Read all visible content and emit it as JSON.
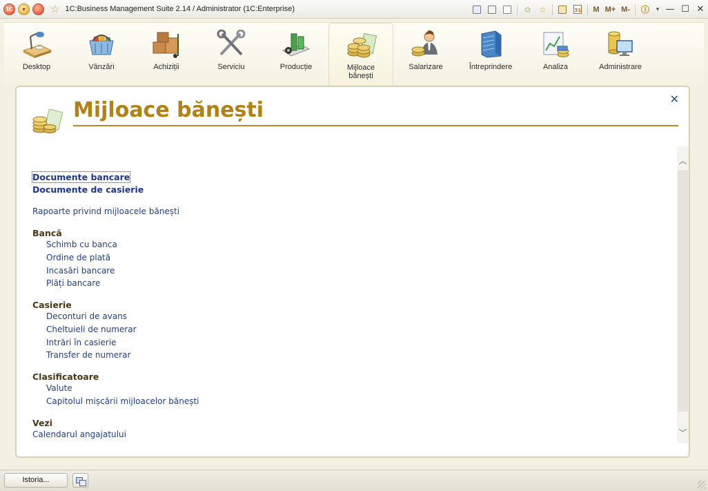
{
  "window": {
    "title": "1C:Business Management Suite 2.14 / Administrator  (1C:Enterprise)",
    "logo_text": "1C",
    "toolbar_text_buttons": [
      "M",
      "M+",
      "M-"
    ]
  },
  "sections": [
    {
      "label": "Desktop",
      "icon": "desk-lamp-icon"
    },
    {
      "label": "Vânzări",
      "icon": "shopping-basket-icon"
    },
    {
      "label": "Achiziții",
      "icon": "boxes-cart-icon"
    },
    {
      "label": "Serviciu",
      "icon": "wrench-icon"
    },
    {
      "label": "Producție",
      "icon": "factory-icon"
    },
    {
      "label": "Mijloace\nbănești",
      "icon": "coins-icon",
      "active": true
    },
    {
      "label": "Salarizare",
      "icon": "employee-icon"
    },
    {
      "label": "Întreprindere",
      "icon": "building-icon"
    },
    {
      "label": "Analiza",
      "icon": "chart-icon"
    },
    {
      "label": "Administrare",
      "icon": "database-computer-icon"
    }
  ],
  "page": {
    "title": "Mijloace bănești",
    "top_links": [
      "Documente bancare",
      "Documente de casierie"
    ],
    "report_link": "Rapoarte privind mijloacele bănești",
    "groups": [
      {
        "title": "Bancă",
        "items": [
          "Schimb cu banca",
          "Ordine de plată",
          "Incasări bancare",
          "Plăți bancare"
        ]
      },
      {
        "title": "Casierie",
        "items": [
          "Deconturi de avans",
          "Cheltuieli de numerar",
          "Intrări în casierie",
          "Transfer de numerar"
        ]
      },
      {
        "title": "Clasificatoare",
        "items": [
          "Valute",
          "Capitolul mișcării mijloacelor bănești"
        ]
      },
      {
        "title": "Vezi",
        "items": [
          "Calendarul angajatului"
        ]
      }
    ]
  },
  "statusbar": {
    "history_button": "Istoria..."
  },
  "colors": {
    "title": "#b28112",
    "link": "#1f3f8a",
    "group": "#4a3516",
    "rule": "#b58a24"
  }
}
